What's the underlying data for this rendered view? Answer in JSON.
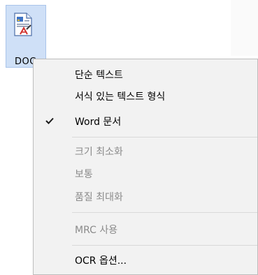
{
  "doc_button": {
    "label": "DOC",
    "icon": "document-icon"
  },
  "menu": {
    "items": [
      {
        "label": "단순 텍스트",
        "enabled": true,
        "checked": false
      },
      {
        "label": "서식 있는 텍스트 형식",
        "enabled": true,
        "checked": false
      },
      {
        "label": "Word 문서",
        "enabled": true,
        "checked": true
      },
      {
        "label": "크기 최소화",
        "enabled": false,
        "checked": false
      },
      {
        "label": "보통",
        "enabled": false,
        "checked": false
      },
      {
        "label": "품질 최대화",
        "enabled": false,
        "checked": false
      },
      {
        "label": "MRC 사용",
        "enabled": false,
        "checked": false
      },
      {
        "label": "OCR 옵션...",
        "enabled": true,
        "checked": false
      }
    ],
    "check_icon": "checkmark-icon"
  },
  "colors": {
    "selection_bg": "#cfe0f7",
    "menu_bg": "#f2f2f2",
    "disabled_text": "#8b8b8b",
    "check": "#1a1a1a"
  }
}
